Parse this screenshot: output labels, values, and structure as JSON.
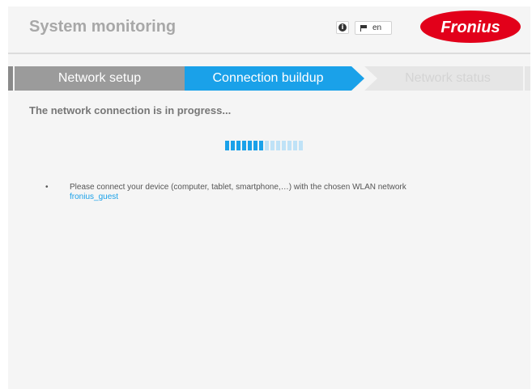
{
  "header": {
    "title": "System monitoring",
    "language": "en",
    "logo_text": "Fronius"
  },
  "steps": [
    {
      "label": "Network setup",
      "state": "done"
    },
    {
      "label": "Connection buildup",
      "state": "active"
    },
    {
      "label": "Network status",
      "state": "pending"
    }
  ],
  "content": {
    "status_heading": "The network connection is in progress...",
    "progress": {
      "total_segments": 14,
      "filled_segments": 7
    },
    "instruction_text": "Please connect your device (computer, tablet, smartphone,…) with the chosen WLAN network",
    "network_name": "fronius_guest"
  },
  "colors": {
    "accent": "#1aa1e9",
    "brand_red": "#e2001a",
    "done_step": "#9b9b9b",
    "pending_step": "#e6e6e6",
    "progress_empty": "#bfe2f7"
  },
  "icons": {
    "info": "info-icon",
    "flag": "flag-icon"
  }
}
